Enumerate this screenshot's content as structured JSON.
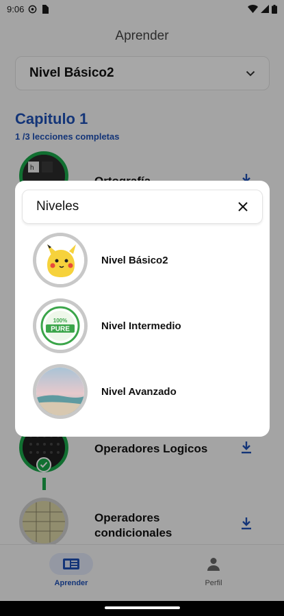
{
  "status_bar": {
    "time": "9:06"
  },
  "header": {
    "title": "Aprender"
  },
  "level_selector": {
    "value": "Nivel Básico2"
  },
  "chapter": {
    "title": "Capitulo 1",
    "progress": "1 /3 lecciones completas"
  },
  "lessons": [
    {
      "title": "Ortografía"
    },
    {
      "title": "Operadores Logicos"
    },
    {
      "title": "Operadores condicionales"
    }
  ],
  "bottom_nav": [
    {
      "label": "Aprender",
      "active": true
    },
    {
      "label": "Perfil",
      "active": false
    }
  ],
  "dialog": {
    "title": "Niveles",
    "options": [
      {
        "label": "Nivel Básico2",
        "icon": "pikachu-avatar"
      },
      {
        "label": "Nivel Intermedio",
        "icon": "100-pure-badge"
      },
      {
        "label": "Nivel Avanzado",
        "icon": "landscape-avatar"
      }
    ]
  },
  "colors": {
    "accent": "#1e4fb3",
    "success": "#1aa64a"
  }
}
